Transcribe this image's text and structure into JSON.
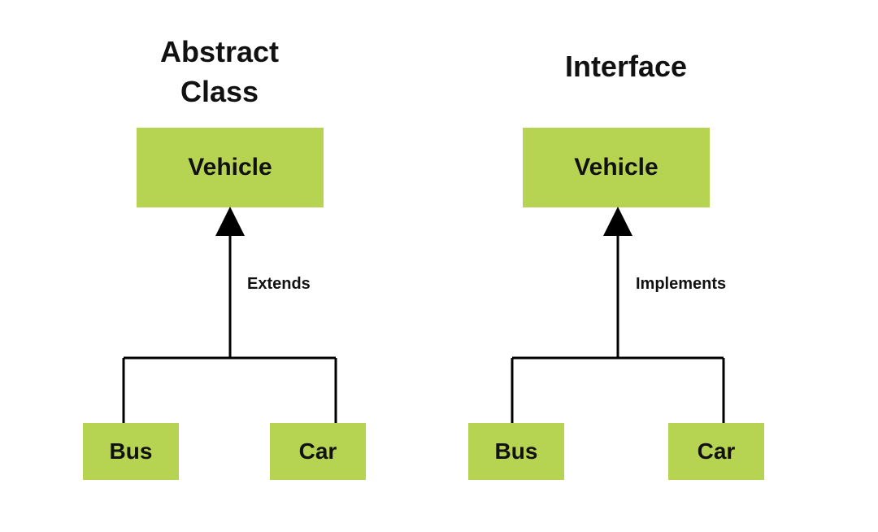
{
  "left": {
    "title_line1": "Abstract",
    "title_line2": "Class",
    "parent": "Vehicle",
    "relation": "Extends",
    "child_left": "Bus",
    "child_right": "Car"
  },
  "right": {
    "title": "Interface",
    "parent": "Vehicle",
    "relation": "Implements",
    "child_left": "Bus",
    "child_right": "Car"
  },
  "colors": {
    "box": "#b7d352",
    "line": "#000000"
  }
}
